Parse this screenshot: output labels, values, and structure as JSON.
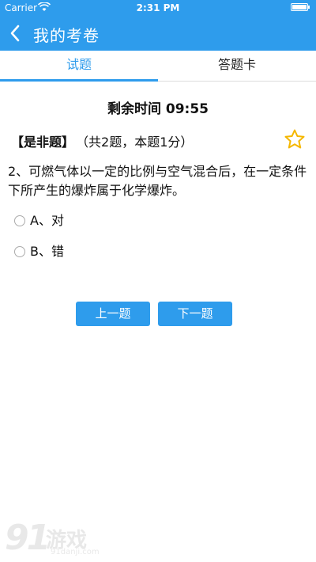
{
  "status_bar": {
    "carrier": "Carrier",
    "time": "2:31 PM"
  },
  "nav": {
    "title": "我的考卷",
    "back_icon": "chevron-left-icon"
  },
  "tabs": [
    {
      "label": "试题",
      "active": true
    },
    {
      "label": "答题卡",
      "active": false
    }
  ],
  "timer": "剩余时间 09:55",
  "question": {
    "type_label": "【是非题】",
    "meta": "（共2题，本题1分）",
    "text": "2、可燃气体以一定的比例与空气混合后，在一定条件下所产生的爆炸属于化学爆炸。",
    "options": [
      {
        "label": "A、对",
        "selected": false
      },
      {
        "label": "B、错",
        "selected": false
      }
    ],
    "favorited": false
  },
  "buttons": {
    "prev": "上一题",
    "next": "下一题"
  },
  "watermark": {
    "brand_num": "91",
    "brand_text": "游戏",
    "url": "91danji.com"
  },
  "colors": {
    "primary": "#2e9cec",
    "star": "#f5b700"
  }
}
